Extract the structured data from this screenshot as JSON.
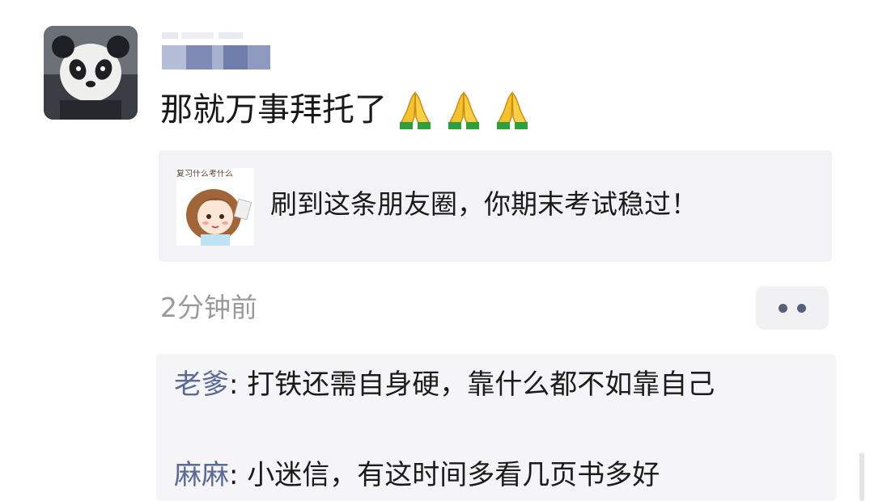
{
  "post": {
    "text": "那就万事拜托了",
    "emojis": [
      "folded-hands",
      "folded-hands",
      "folded-hands"
    ],
    "link_card": {
      "thumb_caption": "复习什么考什么",
      "title": "刷到这条朋友圈，你期末考试稳过！"
    },
    "timestamp": "2分钟前"
  },
  "comments": [
    {
      "author": "老爹",
      "separator": ": ",
      "text": "打铁还需自身硬，靠什么都不如靠自己"
    },
    {
      "author": "麻麻",
      "separator": ": ",
      "text": "小迷信，有这时间多看几页书多好"
    }
  ],
  "colors": {
    "author_link": "#5a6a95",
    "card_bg": "#f3f3f5",
    "timestamp": "#9a9a9a"
  }
}
